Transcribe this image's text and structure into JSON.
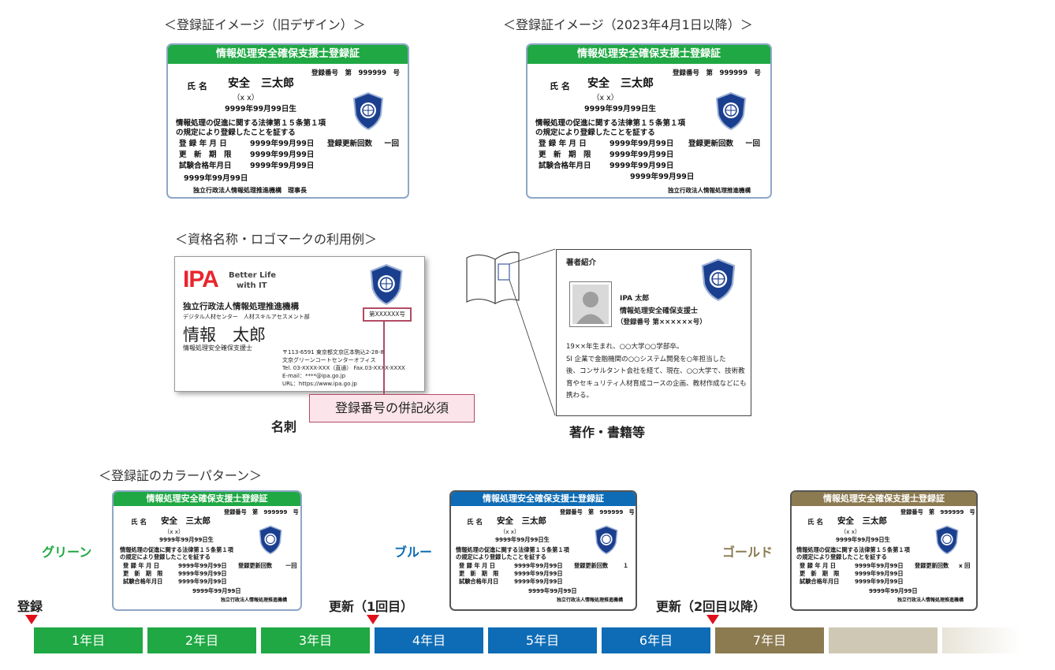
{
  "titles": {
    "old_design": "＜登録証イメージ（旧デザイン）＞",
    "new_design": "＜登録証イメージ（2023年4月1日以降）＞",
    "usage": "＜資格名称・ロゴマークの利用例＞",
    "color_pattern": "＜登録証のカラーパターン＞"
  },
  "card": {
    "header": "情報処理安全確保支援士登録証",
    "reg_no": "登録番号　第　999999　号",
    "name_label": "氏 名",
    "name": "安全　三太郎",
    "kana": "（x x）",
    "birth": "9999年99月99日生",
    "law1": "情報処理の促進に関する法律第１５条第１項",
    "law2": "の規定により登録したことを証する",
    "reg_date_label": "登 録 年 月 日",
    "reg_date": "9999年99月99日",
    "renew_count_label": "登録更新回数",
    "renew_count": "ー回",
    "renew_count_blue": "１",
    "renew_count_gold": "x 回",
    "expiry_label": "更　新　期　限",
    "expiry": "9999年99月99日",
    "exam_label": "試験合格年月日",
    "exam": "9999年99月99日",
    "issue_date": "9999年99月99日",
    "issuer_old": "独立行政法人情報処理推進機構　理事長",
    "issuer_new": "独立行政法人情報処理推進機構"
  },
  "bizcard": {
    "logo": "IPA",
    "tagline1": "Better Life",
    "tagline2": "with IT",
    "org": "独立行政法人情報処理推進機構",
    "dept": "デジタル人材センター　人材スキルアセスメント部",
    "name": "情報　太郎",
    "title": "情報処理安全確保支援士",
    "reg_box": "第XXXXXX号",
    "addr1": "〒113-6591  東京都文京区本駒込2-28-8",
    "addr2": "文京グリーンコートセンターオフィス",
    "tel": "Tel. 03-XXXX-XXX（直通）  Fax.03-XXXX-XXXX",
    "email": "E-mail：****@ipa.go.jp",
    "url": "URL：https://www.ipa.go.jp",
    "caption": "名刺"
  },
  "callout": "登録番号の併記必須",
  "book": {
    "heading": "著者紹介",
    "author": "IPA 太郎",
    "role": "情報処理安全確保支援士",
    "reg": "（登録番号  第××××××号）",
    "bio": [
      "19××年生まれ、○○大学○○学部卒。",
      "SI 企業で金融機関の○○システム開発を○年担当した",
      "後、コンサルタント会社を経て、現在、○○大学で、技術教",
      "育やセキュリティ人材育成コースの企画、教材作成などにも",
      "携わる。"
    ],
    "caption": "著作・書籍等"
  },
  "colors_labels": {
    "green": "グリーン",
    "blue": "ブルー",
    "gold": "ゴールド"
  },
  "colors": {
    "green": "#1fa843",
    "blue": "#0d6cb5",
    "gold": "#8c7a50"
  },
  "timeline": {
    "register": "登録",
    "renew1": "更新（1回目）",
    "renew2": "更新（2回目以降）",
    "years": [
      "1年目",
      "2年目",
      "3年目",
      "4年目",
      "5年目",
      "6年目",
      "7年目"
    ]
  }
}
